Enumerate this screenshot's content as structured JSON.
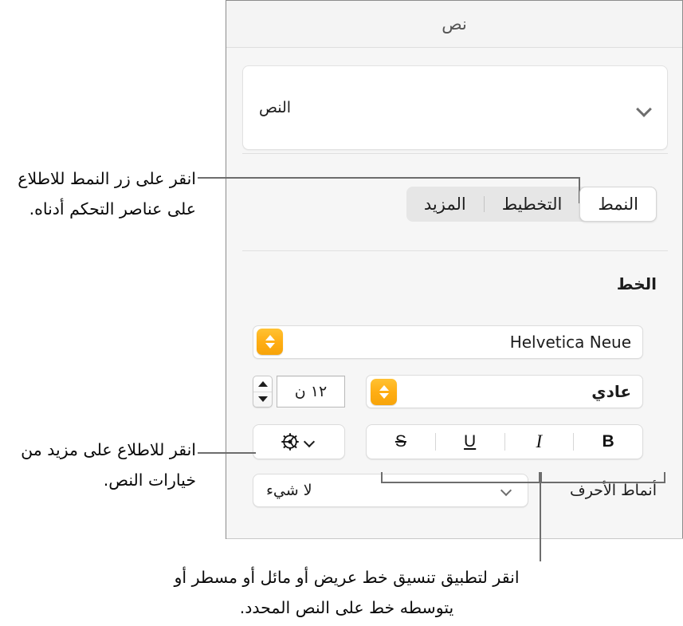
{
  "panel": {
    "title": "نص",
    "object_popup": {
      "label": "النص",
      "chevron_icon": "chevron-down-icon"
    },
    "segmented_control": {
      "segments": [
        {
          "label": "النمط",
          "selected": true
        },
        {
          "label": "التخطيط",
          "selected": false
        },
        {
          "label": "المزيد",
          "selected": false
        }
      ]
    },
    "font_section": {
      "heading": "الخط",
      "font_family": {
        "value": "Helvetica Neue",
        "stepper_icon": "up-down-stepper-icon"
      },
      "typeface": {
        "value": "عادي",
        "stepper_icon": "up-down-stepper-icon"
      },
      "font_size": {
        "value": "١٢ ن",
        "stepper_icon": "up-down-arrows-icon"
      },
      "style_buttons": [
        {
          "label": "B",
          "name": "bold"
        },
        {
          "label": "I",
          "name": "italic"
        },
        {
          "label": "U",
          "name": "underline"
        },
        {
          "label": "S",
          "name": "strikethrough"
        }
      ],
      "more_options": {
        "gear_icon": "gear-icon",
        "chevron_icon": "chevron-down-icon"
      },
      "character_styles": {
        "label": "أنماط الأحرف",
        "value": "لا شيء",
        "chevron_icon": "chevron-down-icon"
      }
    }
  },
  "callouts": [
    {
      "text": "انقر على زر النمط للاطلاع على عناصر التحكم أدناه."
    },
    {
      "text": "انقر للاطلاع على مزيد من خيارات النص."
    },
    {
      "text": "انقر لتطبيق تنسيق خط عريض أو مائل أو مسطر أو يتوسطه خط على النص المحدد."
    }
  ],
  "colors": {
    "panel_background": "#f6f6f6",
    "accent_orange": "#ffae14",
    "leader_line": "#6d6d6d",
    "text": "#1c1c1c"
  }
}
